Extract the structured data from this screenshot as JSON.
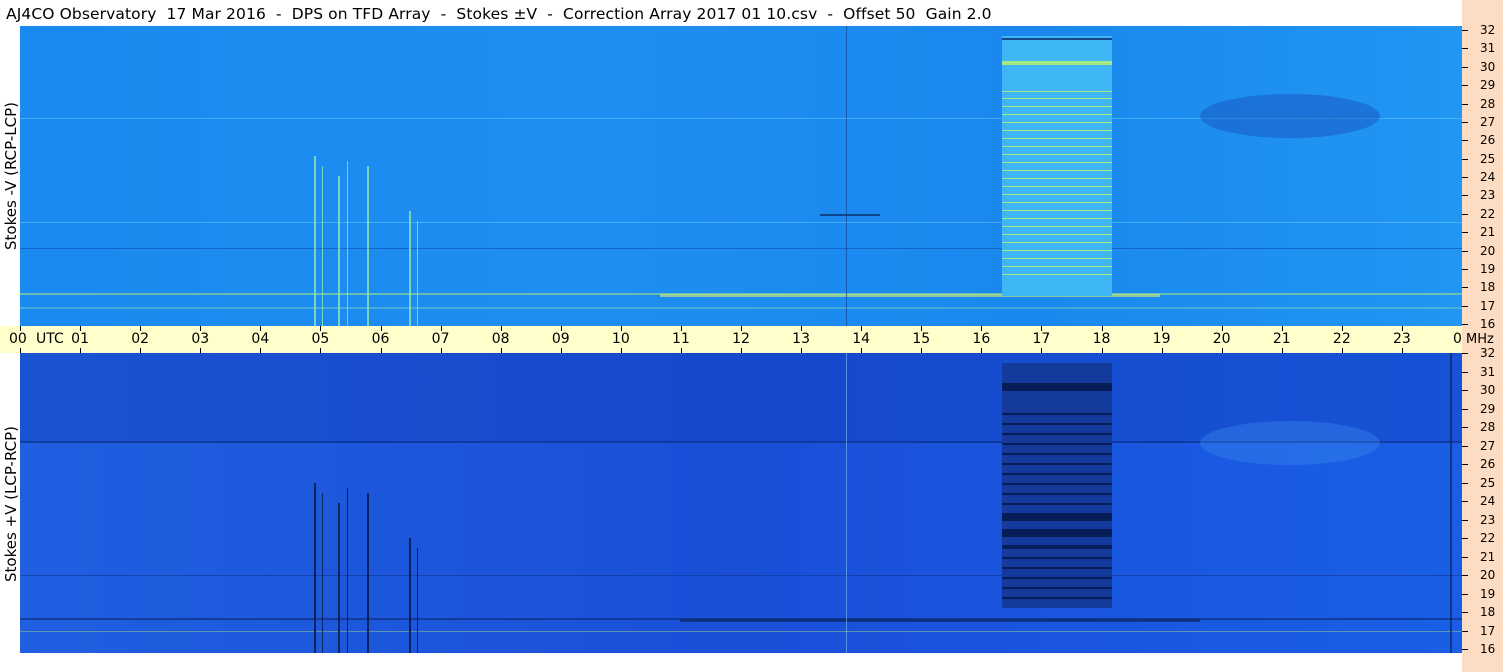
{
  "title": "AJ4CO Observatory  17 Mar 2016  -  DPS on TFD Array  -  Stokes ±V  -  Correction Array 2017 01 10.csv  -  Offset 50  Gain 2.0",
  "panels": {
    "top": {
      "label": "Stokes -V (RCP-LCP)"
    },
    "bottom": {
      "label": "Stokes +V (LCP-RCP)"
    }
  },
  "time_axis": {
    "unit": "UTC",
    "ticks": [
      "00",
      "01",
      "02",
      "03",
      "04",
      "05",
      "06",
      "07",
      "08",
      "09",
      "10",
      "11",
      "12",
      "13",
      "14",
      "15",
      "16",
      "17",
      "18",
      "19",
      "20",
      "21",
      "22",
      "23",
      "00"
    ]
  },
  "freq_axis": {
    "unit": "MHz",
    "ticks": [
      "32",
      "31",
      "30",
      "29",
      "28",
      "27",
      "26",
      "25",
      "24",
      "23",
      "22",
      "21",
      "20",
      "19",
      "18",
      "17",
      "16"
    ]
  },
  "colors": {
    "top_background": "#1a8ff0",
    "bottom_background": "#1a56e0",
    "axis_band": "#ffffcc",
    "freq_band": "#fcdcc2"
  }
}
